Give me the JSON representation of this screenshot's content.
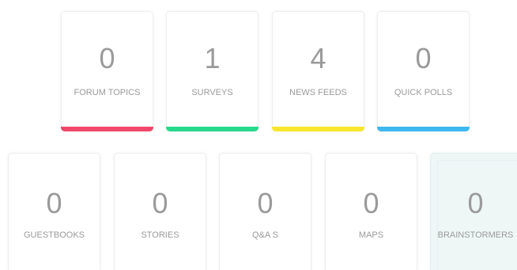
{
  "top_row": [
    {
      "count": "0",
      "label": "FORUM TOPICS",
      "accent": "#f0476a"
    },
    {
      "count": "1",
      "label": "SURVEYS",
      "accent": "#27d98b"
    },
    {
      "count": "4",
      "label": "NEWS FEEDS",
      "accent": "#f7e62c"
    },
    {
      "count": "0",
      "label": "QUICK POLLS",
      "accent": "#3eb8f0"
    }
  ],
  "bottom_row": [
    {
      "count": "0",
      "label": "GUESTBOOKS"
    },
    {
      "count": "0",
      "label": "STORIES"
    },
    {
      "count": "0",
      "label": "Q&A S"
    },
    {
      "count": "0",
      "label": "MAPS"
    },
    {
      "count": "0",
      "label": "BRAINSTORMERS"
    }
  ]
}
